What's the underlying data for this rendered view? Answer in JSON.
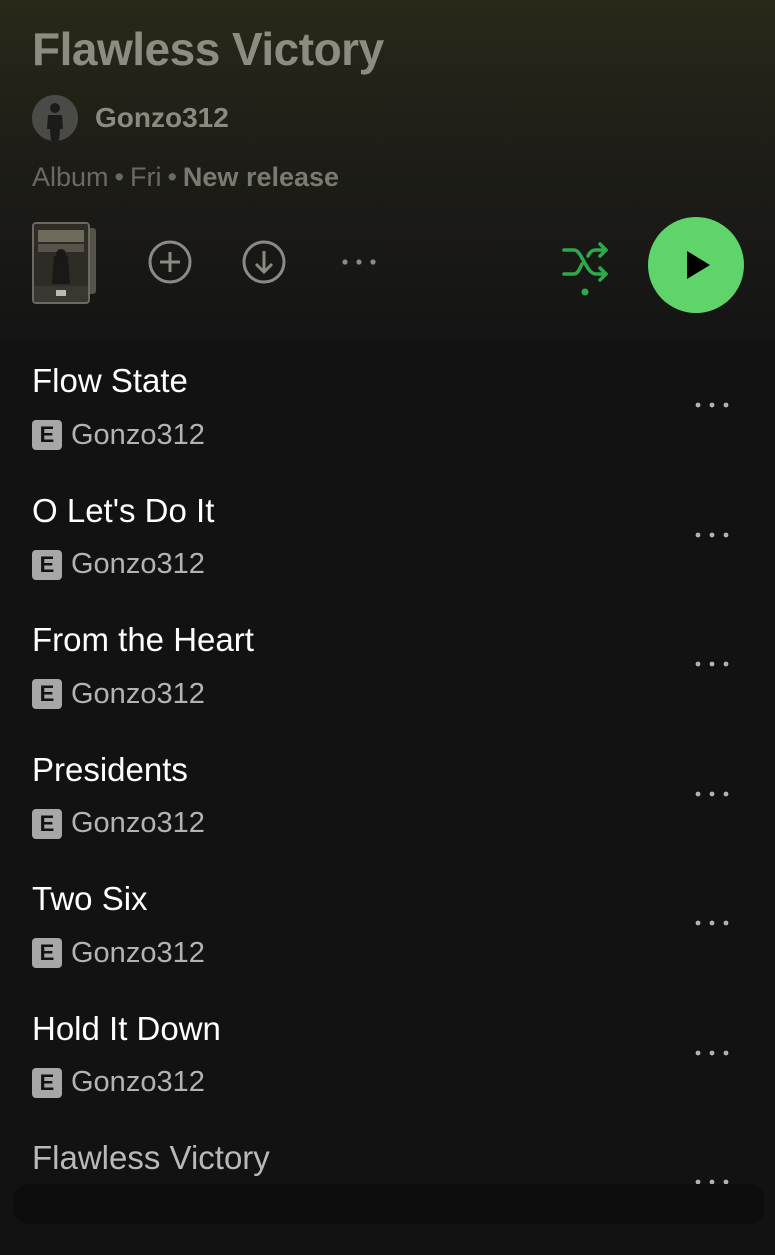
{
  "album": {
    "title": "Flawless Victory",
    "artist": "Gonzo312",
    "type": "Album",
    "day": "Fri",
    "status": "New release",
    "separator": "•"
  },
  "controls": {
    "add_icon": "plus-circle-icon",
    "download_icon": "download-circle-icon",
    "more_icon": "more-horizontal-icon",
    "shuffle_icon": "shuffle-icon",
    "play_icon": "play-icon",
    "shuffle_color": "#1DB954",
    "play_color": "#5FD46B"
  },
  "tracks": [
    {
      "title": "Flow State",
      "explicit_badge": "E",
      "artist": "Gonzo312"
    },
    {
      "title": "O Let's Do It",
      "explicit_badge": "E",
      "artist": "Gonzo312"
    },
    {
      "title": "From the Heart",
      "explicit_badge": "E",
      "artist": "Gonzo312"
    },
    {
      "title": "Presidents",
      "explicit_badge": "E",
      "artist": "Gonzo312"
    },
    {
      "title": "Two Six",
      "explicit_badge": "E",
      "artist": "Gonzo312"
    },
    {
      "title": "Hold It Down",
      "explicit_badge": "E",
      "artist": "Gonzo312"
    },
    {
      "title": "Flawless Victory"
    }
  ]
}
